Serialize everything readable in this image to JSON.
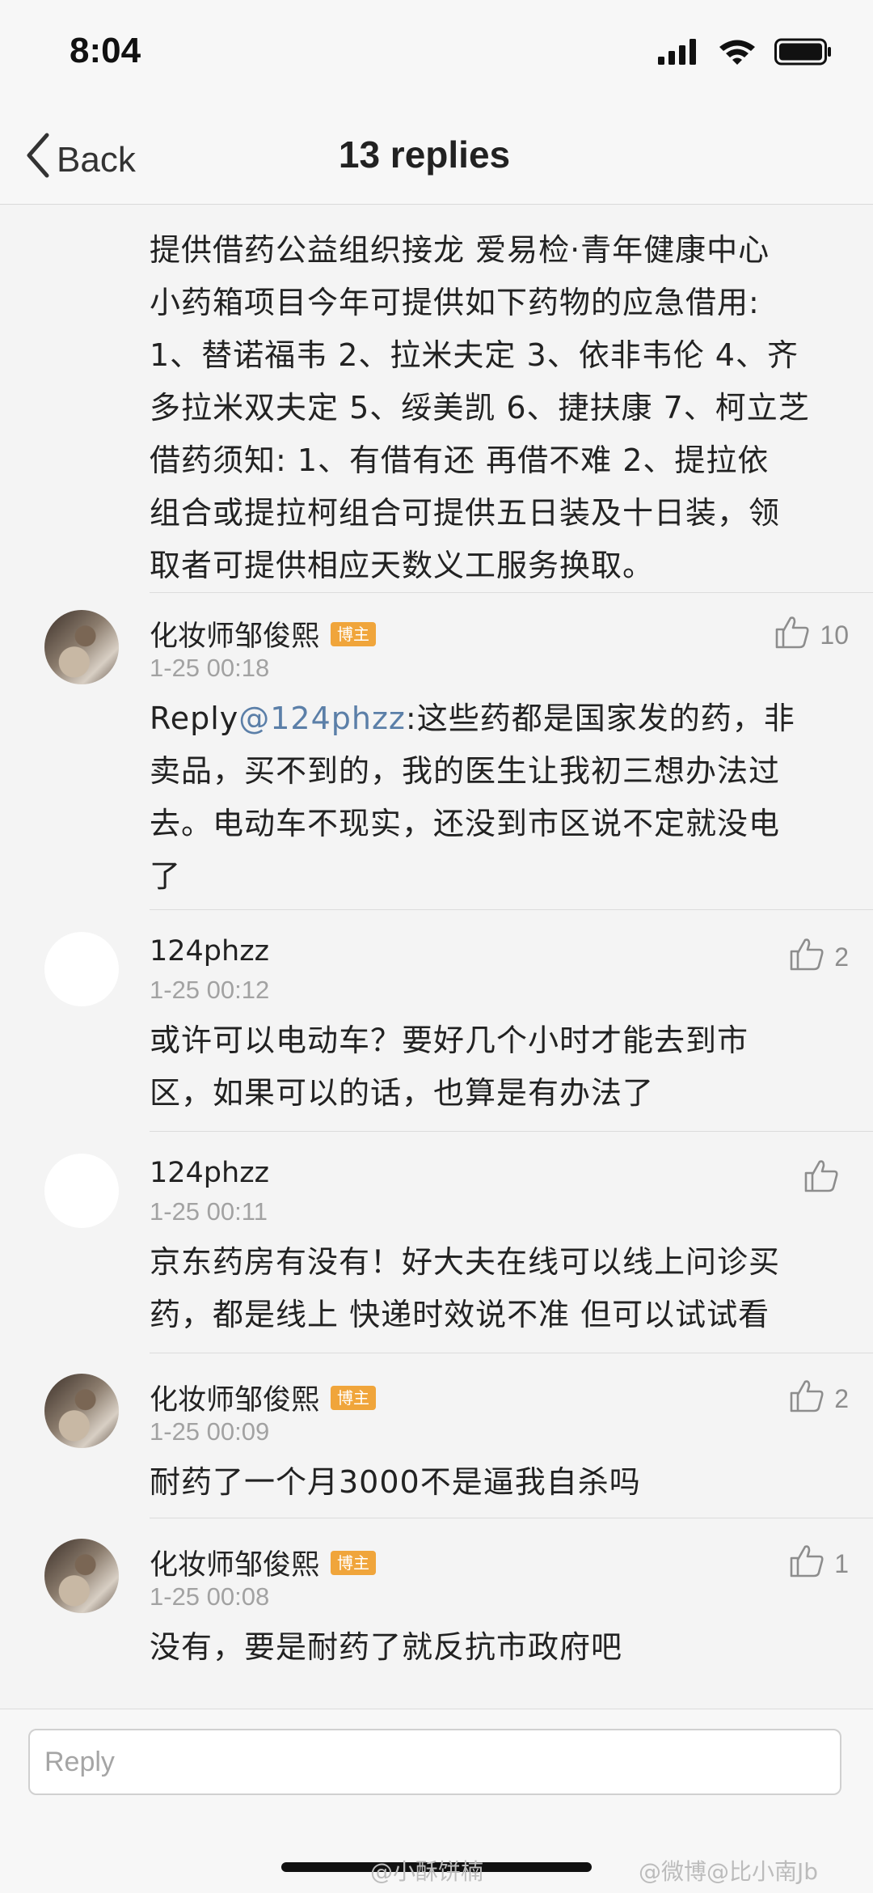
{
  "status_bar": {
    "time": "8:04"
  },
  "nav": {
    "back_label": "Back",
    "title": "13 replies"
  },
  "top_comment": {
    "lines": [
      "提供借药公益组织接龙  爱易检·青年健康中心",
      "小药箱项目今年可提供如下药物的应急借用:",
      "1、替诺福韦 2、拉米夫定 3、依非韦伦 4、齐",
      "多拉米双夫定 5、绥美凯 6、捷扶康 7、柯立芝",
      "借药须知:  1、有借有还 再借不难 2、提拉依",
      "组合或提拉柯组合可提供五日装及十日装，领",
      "取者可提供相应天数义工服务换取。"
    ]
  },
  "comments": [
    {
      "user": "化妆师邹俊熙",
      "badge": "博主",
      "time": "1-25 00:18",
      "likes": "10",
      "reply_prefix": "Reply",
      "mention": "@124phzz",
      "line1_rest": ":这些药都是国家发的药，非",
      "lines": [
        "卖品，买不到的，我的医生让我初三想办法过",
        "去。电动车不现实，还没到市区说不定就没电",
        "了"
      ]
    },
    {
      "user": "124phzz",
      "time": "1-25 00:12",
      "likes": "2",
      "lines": [
        "或许可以电动车？要好几个小时才能去到市",
        "区，如果可以的话，也算是有办法了"
      ]
    },
    {
      "user": "124phzz",
      "time": "1-25 00:11",
      "likes": "",
      "lines": [
        "京东药房有没有！好大夫在线可以线上问诊买",
        "药，都是线上 快递时效说不准 但可以试试看"
      ]
    },
    {
      "user": "化妆师邹俊熙",
      "badge": "博主",
      "time": "1-25 00:09",
      "likes": "2",
      "lines": [
        "耐药了一个月3000不是逼我自杀吗"
      ]
    },
    {
      "user": "化妆师邹俊熙",
      "badge": "博主",
      "time": "1-25 00:08",
      "likes": "1",
      "lines": [
        "没有，要是耐药了就反抗市政府吧"
      ]
    }
  ],
  "reply_box": {
    "placeholder": "Reply"
  },
  "watermarks": {
    "left": "@小酥饼楠",
    "right": "@微博@比小南Jb"
  },
  "colors": {
    "badge": "#f0a53b",
    "mention": "#5b7fa8",
    "background": "#f4f4f4"
  }
}
